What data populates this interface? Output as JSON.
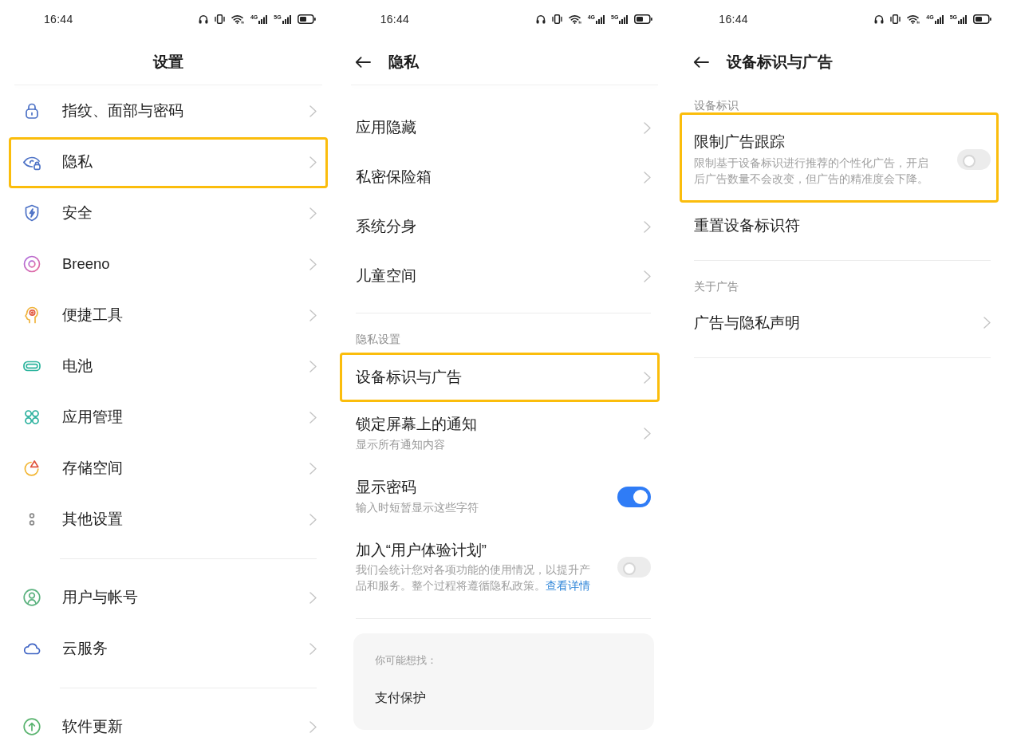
{
  "screens": [
    {
      "status_bar": {
        "time": "16:44",
        "signals": [
          {
            "label": "4G"
          },
          {
            "label": "5G"
          }
        ]
      },
      "header": {
        "title": "设置",
        "back": false,
        "divider": true
      },
      "icons": true,
      "groups": [
        {
          "items": [
            {
              "label": "指纹、面部与密码",
              "kind": "nav",
              "highlighted": false
            },
            {
              "label": "隐私",
              "kind": "nav",
              "highlighted": true
            },
            {
              "label": "安全",
              "kind": "nav",
              "highlighted": false
            },
            {
              "label": "Breeno",
              "kind": "nav",
              "highlighted": false
            },
            {
              "label": "便捷工具",
              "kind": "nav",
              "highlighted": false
            },
            {
              "label": "电池",
              "kind": "nav",
              "highlighted": false
            },
            {
              "label": "应用管理",
              "kind": "nav",
              "highlighted": false
            },
            {
              "label": "存储空间",
              "kind": "nav",
              "highlighted": false
            },
            {
              "label": "其他设置",
              "kind": "nav",
              "highlighted": false
            }
          ]
        },
        {
          "items": [
            {
              "label": "用户与帐号",
              "kind": "nav",
              "highlighted": false
            },
            {
              "label": "云服务",
              "kind": "nav",
              "highlighted": false
            }
          ]
        },
        {
          "items": [
            {
              "label": "软件更新",
              "kind": "nav",
              "highlighted": false
            }
          ]
        }
      ]
    },
    {
      "status_bar": {
        "time": "16:44",
        "signals": [
          {
            "label": "4G"
          },
          {
            "label": "5G"
          }
        ]
      },
      "header": {
        "title": "隐私",
        "back": true,
        "divider": true
      },
      "groups": [
        {
          "items": [
            {
              "label": "应用隐藏",
              "kind": "nav",
              "highlighted": false
            },
            {
              "label": "私密保险箱",
              "kind": "nav",
              "highlighted": false
            },
            {
              "label": "系统分身",
              "kind": "nav",
              "highlighted": false
            },
            {
              "label": "儿童空间",
              "kind": "nav",
              "highlighted": false
            }
          ]
        },
        {
          "header": "隐私设置",
          "items": [
            {
              "label": "设备标识与广告",
              "kind": "nav",
              "highlighted": true
            },
            {
              "label": "锁定屏幕上的通知",
              "kind": "nav",
              "subtitle": "显示所有通知内容",
              "highlighted": false
            },
            {
              "label": "显示密码",
              "kind": "switch",
              "subtitle": "输入时短暂显示这些字符",
              "on": true,
              "highlighted": false
            },
            {
              "label": "加入“用户体验计划”",
              "kind": "switch",
              "description": "我们会统计您对各项功能的使用情况，以提升产品和服务。整个过程将遵循隐私政策。",
              "link": "查看详情",
              "on": false,
              "highlighted": false
            }
          ]
        }
      ],
      "suggestions": {
        "title": "你可能想找：",
        "items": [
          "支付保护"
        ]
      }
    },
    {
      "status_bar": {
        "time": "16:44",
        "signals": [
          {
            "label": "4G"
          },
          {
            "label": "5G"
          }
        ]
      },
      "header": {
        "title": "设备标识与广告",
        "back": true
      },
      "groups": [
        {
          "header": "设备标识",
          "items": [
            {
              "label": "限制广告跟踪",
              "kind": "switch",
              "description": "限制基于设备标识进行推荐的个性化广告，开启后广告数量不会改变，但广告的精准度会下降。",
              "on": false,
              "highlighted": true
            },
            {
              "label": "重置设备标识符",
              "kind": "plain",
              "highlighted": false
            }
          ]
        },
        {
          "header": "关于广告",
          "items": [
            {
              "label": "广告与隐私声明",
              "kind": "nav",
              "highlighted": false
            }
          ]
        }
      ]
    }
  ]
}
